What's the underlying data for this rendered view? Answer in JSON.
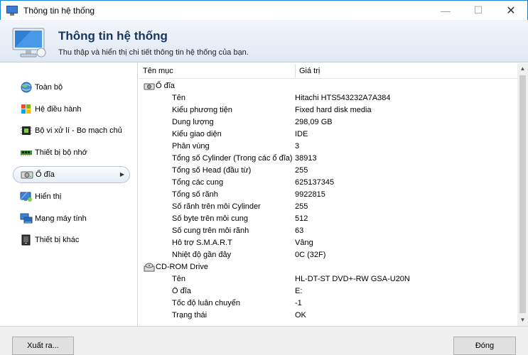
{
  "window": {
    "title": "Thông tin hệ thống",
    "minimize_glyph": "—",
    "maximize_glyph": "☐",
    "close_glyph": "✕"
  },
  "banner": {
    "heading": "Thông tin hệ thống",
    "subtitle": "Thu thập và hiển thị chi tiết thông tin hệ thống của bạn."
  },
  "sidebar": {
    "items": [
      {
        "label": "Toàn bộ",
        "icon": "globe-icon"
      },
      {
        "label": "Hệ điều hành",
        "icon": "windows-logo-icon"
      },
      {
        "label": "Bộ vi xử lí - Bo mạch chủ",
        "icon": "chip-icon"
      },
      {
        "label": "Thiết bị bộ nhớ",
        "icon": "memory-stick-icon"
      },
      {
        "label": "Ổ đĩa",
        "icon": "hard-disk-icon",
        "selected": true
      },
      {
        "label": "Hiển thị",
        "icon": "display-icon"
      },
      {
        "label": "Mạng máy tính",
        "icon": "network-icon"
      },
      {
        "label": "Thiết bị khác",
        "icon": "device-icon"
      }
    ]
  },
  "table": {
    "col_name": "Tên mục",
    "col_value": "Giá trị",
    "groups": [
      {
        "label": "Ổ đĩa",
        "rows": [
          [
            "Tên",
            "Hitachi HTS543232A7A384"
          ],
          [
            "Kiểu phương tiện",
            "Fixed hard disk media"
          ],
          [
            "Dung lượng",
            "298,09 GB"
          ],
          [
            "Kiểu giao diện",
            "IDE"
          ],
          [
            "Phân vùng",
            "3"
          ],
          [
            "Tổng số Cylinder (Trong các ổ đĩa)",
            "38913"
          ],
          [
            "Tổng số Head (đầu từ)",
            "255"
          ],
          [
            "Tổng các cung",
            "625137345"
          ],
          [
            "Tổng số rãnh",
            "9922815"
          ],
          [
            "Số rãnh trên mỗi Cylinder",
            "255"
          ],
          [
            "Số byte trên mỗi cung",
            "512"
          ],
          [
            "Số cung trên mỗi rãnh",
            "63"
          ],
          [
            "Hỗ trợ S.M.A.R.T",
            "Vâng"
          ],
          [
            "Nhiệt độ gần đây",
            "0C (32F)"
          ]
        ]
      },
      {
        "label": "CD-ROM Drive",
        "rows": [
          [
            "Tên",
            "HL-DT-ST DVD+-RW GSA-U20N"
          ],
          [
            "Ổ đĩa",
            "E:"
          ],
          [
            "Tốc độ luân chuyển",
            "-1"
          ],
          [
            "Trạng thái",
            "OK"
          ]
        ]
      }
    ]
  },
  "footer": {
    "export_label": "Xuất ra...",
    "close_label": "Đóng"
  }
}
